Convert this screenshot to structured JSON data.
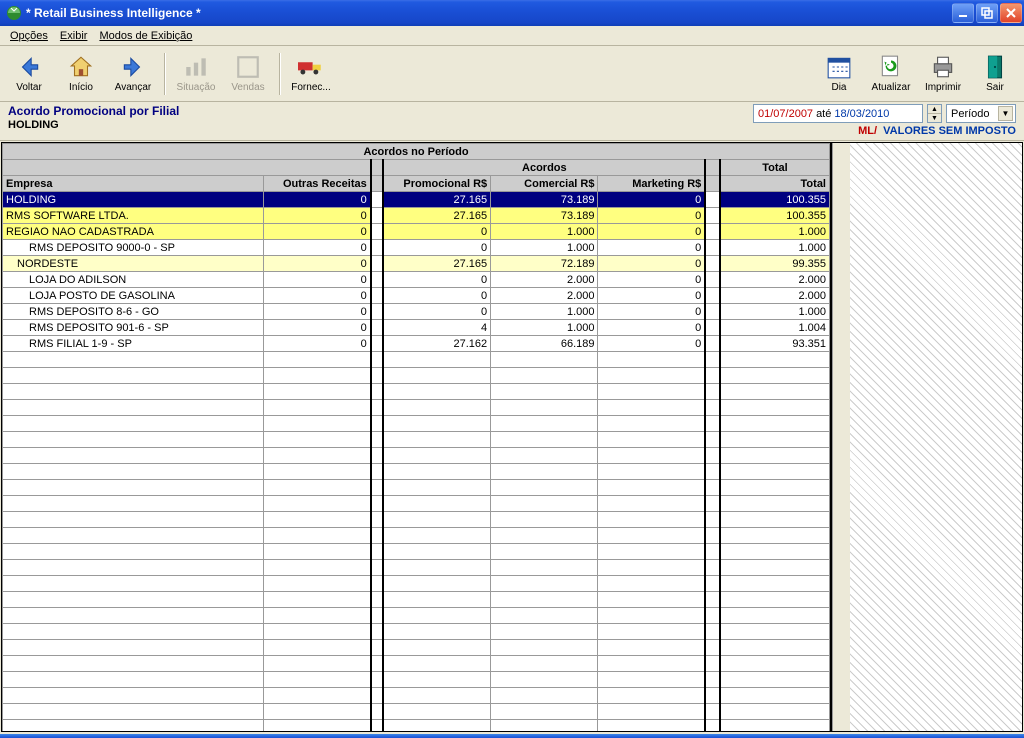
{
  "window": {
    "title": "* Retail Business Intelligence *"
  },
  "menu": {
    "opcoes": "Opções",
    "exibir": "Exibir",
    "modos": "Modos de Exibição"
  },
  "toolbar": {
    "voltar": "Voltar",
    "inicio": "Início",
    "avancar": "Avançar",
    "situacao": "Situação",
    "vendas": "Vendas",
    "fornec": "Fornec...",
    "dia": "Dia",
    "atualizar": "Atualizar",
    "imprimir": "Imprimir",
    "sair": "Sair"
  },
  "report": {
    "title": "Acordo Promocional por Filial",
    "subtitle": "HOLDING",
    "date_from": "01/07/2007",
    "date_mid": "até",
    "date_to": "18/03/2010",
    "period_label": "Período",
    "ml": "ML/",
    "tax_note": "VALORES SEM IMPOSTO"
  },
  "grid": {
    "super_title": "Acordos no Período",
    "group_acordos": "Acordos",
    "group_total": "Total",
    "cols": {
      "empresa": "Empresa",
      "outras": "Outras Receitas",
      "promo": "Promocional R$",
      "comercial": "Comercial R$",
      "marketing": "Marketing R$",
      "total": "Total"
    },
    "rows": [
      {
        "style": "blue",
        "indent": 0,
        "empresa": "HOLDING",
        "outras": "0",
        "promo": "27.165",
        "com": "73.189",
        "mkt": "0",
        "tot": "100.355"
      },
      {
        "style": "yellow",
        "indent": 0,
        "empresa": "RMS SOFTWARE LTDA.",
        "outras": "0",
        "promo": "27.165",
        "com": "73.189",
        "mkt": "0",
        "tot": "100.355"
      },
      {
        "style": "yellow",
        "indent": 0,
        "empresa": "REGIAO NAO CADASTRADA",
        "outras": "0",
        "promo": "0",
        "com": "1.000",
        "mkt": "0",
        "tot": "1.000"
      },
      {
        "style": "white",
        "indent": 2,
        "empresa": "RMS DEPOSITO 9000-0 - SP",
        "outras": "0",
        "promo": "0",
        "com": "1.000",
        "mkt": "0",
        "tot": "1.000"
      },
      {
        "style": "lyellow",
        "indent": 1,
        "empresa": "NORDESTE",
        "outras": "0",
        "promo": "27.165",
        "com": "72.189",
        "mkt": "0",
        "tot": "99.355"
      },
      {
        "style": "white",
        "indent": 2,
        "empresa": "LOJA DO ADILSON",
        "outras": "0",
        "promo": "0",
        "com": "2.000",
        "mkt": "0",
        "tot": "2.000"
      },
      {
        "style": "white",
        "indent": 2,
        "empresa": "LOJA POSTO DE GASOLINA",
        "outras": "0",
        "promo": "0",
        "com": "2.000",
        "mkt": "0",
        "tot": "2.000"
      },
      {
        "style": "white",
        "indent": 2,
        "empresa": "RMS DEPOSITO 8-6 - GO",
        "outras": "0",
        "promo": "0",
        "com": "1.000",
        "mkt": "0",
        "tot": "1.000"
      },
      {
        "style": "white",
        "indent": 2,
        "empresa": "RMS DEPOSITO 901-6 - SP",
        "outras": "0",
        "promo": "4",
        "com": "1.000",
        "mkt": "0",
        "tot": "1.004"
      },
      {
        "style": "white",
        "indent": 2,
        "empresa": "RMS FILIAL 1-9 - SP",
        "outras": "0",
        "promo": "27.162",
        "com": "66.189",
        "mkt": "0",
        "tot": "93.351"
      }
    ],
    "empty_rows": 24
  }
}
